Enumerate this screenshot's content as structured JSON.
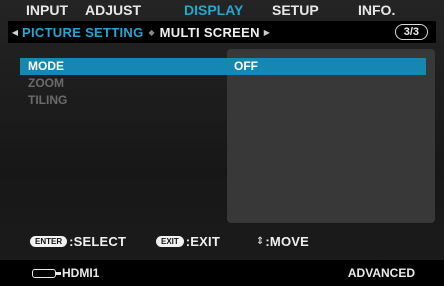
{
  "tabs": [
    {
      "label": "INPUT",
      "active": false
    },
    {
      "label": "ADJUST",
      "active": false
    },
    {
      "label": "DISPLAY",
      "active": true
    },
    {
      "label": "SETUP",
      "active": false
    },
    {
      "label": "INFO.",
      "active": false
    }
  ],
  "subtabs": {
    "left_arrow": "◀",
    "active_label": "PICTURE SETTING",
    "separator": "◆",
    "next_label": "MULTI SCREEN",
    "right_arrow": "▶",
    "page_indicator": "3/3"
  },
  "menu": {
    "items": [
      {
        "label": "MODE",
        "value": "OFF",
        "state": "selected"
      },
      {
        "label": "ZOOM",
        "value": "",
        "state": "disabled"
      },
      {
        "label": "TILING",
        "value": "",
        "state": "disabled"
      }
    ]
  },
  "hints": {
    "enter_key": "ENTER",
    "enter_text": ":SELECT",
    "exit_key": "EXIT",
    "exit_text": ":EXIT",
    "move_arrow": "⇕",
    "move_text": ":MOVE"
  },
  "status": {
    "source_icon": "hdmi-cable-icon",
    "source_label": "HDMI1",
    "mode_label": "ADVANCED"
  },
  "colors": {
    "accent": "#26a6d0",
    "selected_row": "#1686b3"
  }
}
